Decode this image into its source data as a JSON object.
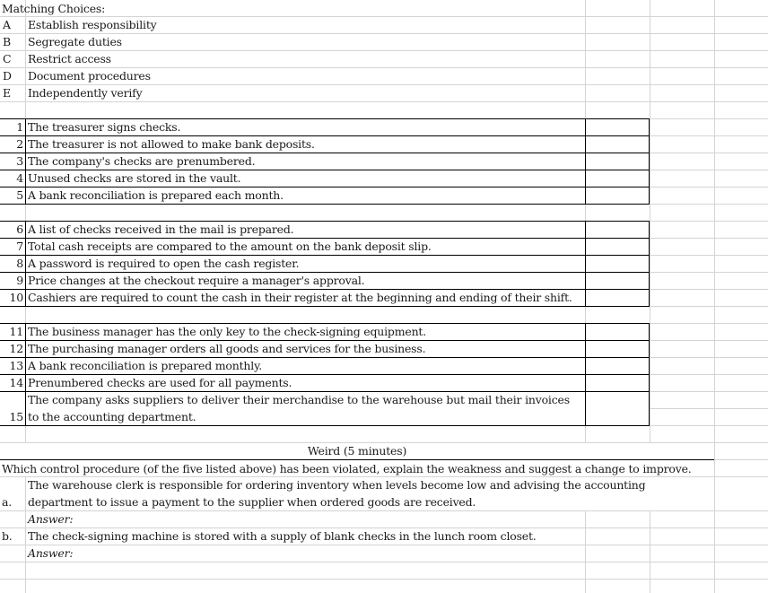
{
  "sheet": {
    "matching_title": "Matching Choices:",
    "choices": [
      {
        "letter": "A",
        "label": "Establish responsibility"
      },
      {
        "letter": "B",
        "label": "Segregate duties"
      },
      {
        "letter": "C",
        "label": "Restrict access"
      },
      {
        "letter": "D",
        "label": "Document procedures"
      },
      {
        "letter": "E",
        "label": "Independently verify"
      }
    ],
    "items": [
      {
        "num": "1",
        "text": "The treasurer signs checks.",
        "answer": ""
      },
      {
        "num": "2",
        "text": "The treasurer is not allowed to make bank deposits.",
        "answer": ""
      },
      {
        "num": "3",
        "text": "The company's checks are prenumbered.",
        "answer": ""
      },
      {
        "num": "4",
        "text": "Unused checks are stored in the vault.",
        "answer": ""
      },
      {
        "num": "5",
        "text": "A bank reconciliation is prepared each month.",
        "answer": ""
      },
      {
        "num": "6",
        "text": "A list of checks received in the mail is prepared.",
        "answer": ""
      },
      {
        "num": "7",
        "text": "Total cash receipts are compared to the amount on the bank deposit slip.",
        "answer": ""
      },
      {
        "num": "8",
        "text": "A password is required to open the cash register.",
        "answer": ""
      },
      {
        "num": "9",
        "text": "Price changes at the checkout require a manager's approval.",
        "answer": ""
      },
      {
        "num": "10",
        "text": "Cashiers are required to count the cash in their register at the beginning and ending of their shift.",
        "answer": ""
      },
      {
        "num": "11",
        "text": "The business manager has the only key to the check-signing equipment.",
        "answer": ""
      },
      {
        "num": "12",
        "text": "The purchasing manager orders all goods and services for the business.",
        "answer": ""
      },
      {
        "num": "13",
        "text": "A bank reconciliation is prepared monthly.",
        "answer": ""
      },
      {
        "num": "14",
        "text": "Prenumbered checks are used for all payments.",
        "answer": ""
      },
      {
        "num": "15",
        "text_line1": "The company asks suppliers to deliver their merchandise to the warehouse but mail their invoices",
        "text_line2": "to the accounting department.",
        "answer": ""
      }
    ],
    "weird": {
      "heading": "Weird (5 minutes)",
      "instruction": "Which control procedure (of the five listed above) has been violated, explain the weakness and suggest a change to improve.",
      "questions": [
        {
          "label": "a.",
          "line1": "The warehouse clerk is responsible for ordering inventory when levels become low and advising the accounting",
          "line2": "department to issue a payment to the supplier when ordered goods are received.",
          "answer_label": "Answer:"
        },
        {
          "label": "b.",
          "line1": "The check-signing machine is stored with a supply of blank checks in the lunch room closet.",
          "answer_label": "Answer:"
        }
      ]
    }
  }
}
